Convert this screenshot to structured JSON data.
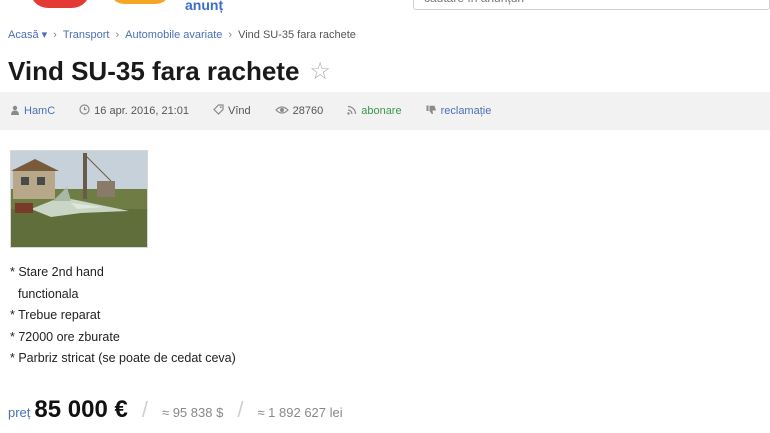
{
  "header": {
    "logo_text": "anunț",
    "search_placeholder": "cautare în anunțuri"
  },
  "breadcrumb": {
    "items": [
      "Acasă ▾",
      "Transport",
      "Automobile avariate"
    ],
    "current": "Vind SU-35 fara rachete"
  },
  "listing": {
    "title": "Vind SU-35 fara rachete",
    "meta": {
      "author": "HamC",
      "date": "16 apr. 2016, 21:01",
      "type": "Vînd",
      "views": "28760",
      "subscribe": "abonare",
      "report": "reclamație"
    },
    "features": [
      "* Stare 2nd hand",
      "  functionala",
      "* Trebue reparat",
      "* 72000 ore zburate",
      "* Parbriz stricat (se poate de cedat ceva)"
    ],
    "price": {
      "label": "preț",
      "value": "85 000 €",
      "usd": "≈ 95 838 $",
      "mdl": "≈ 1 892 627 lei"
    }
  },
  "colors": {
    "link": "#4a6fb5",
    "subscribe": "#3a9a4a",
    "meta_bar_bg": "#f2f2f2"
  }
}
